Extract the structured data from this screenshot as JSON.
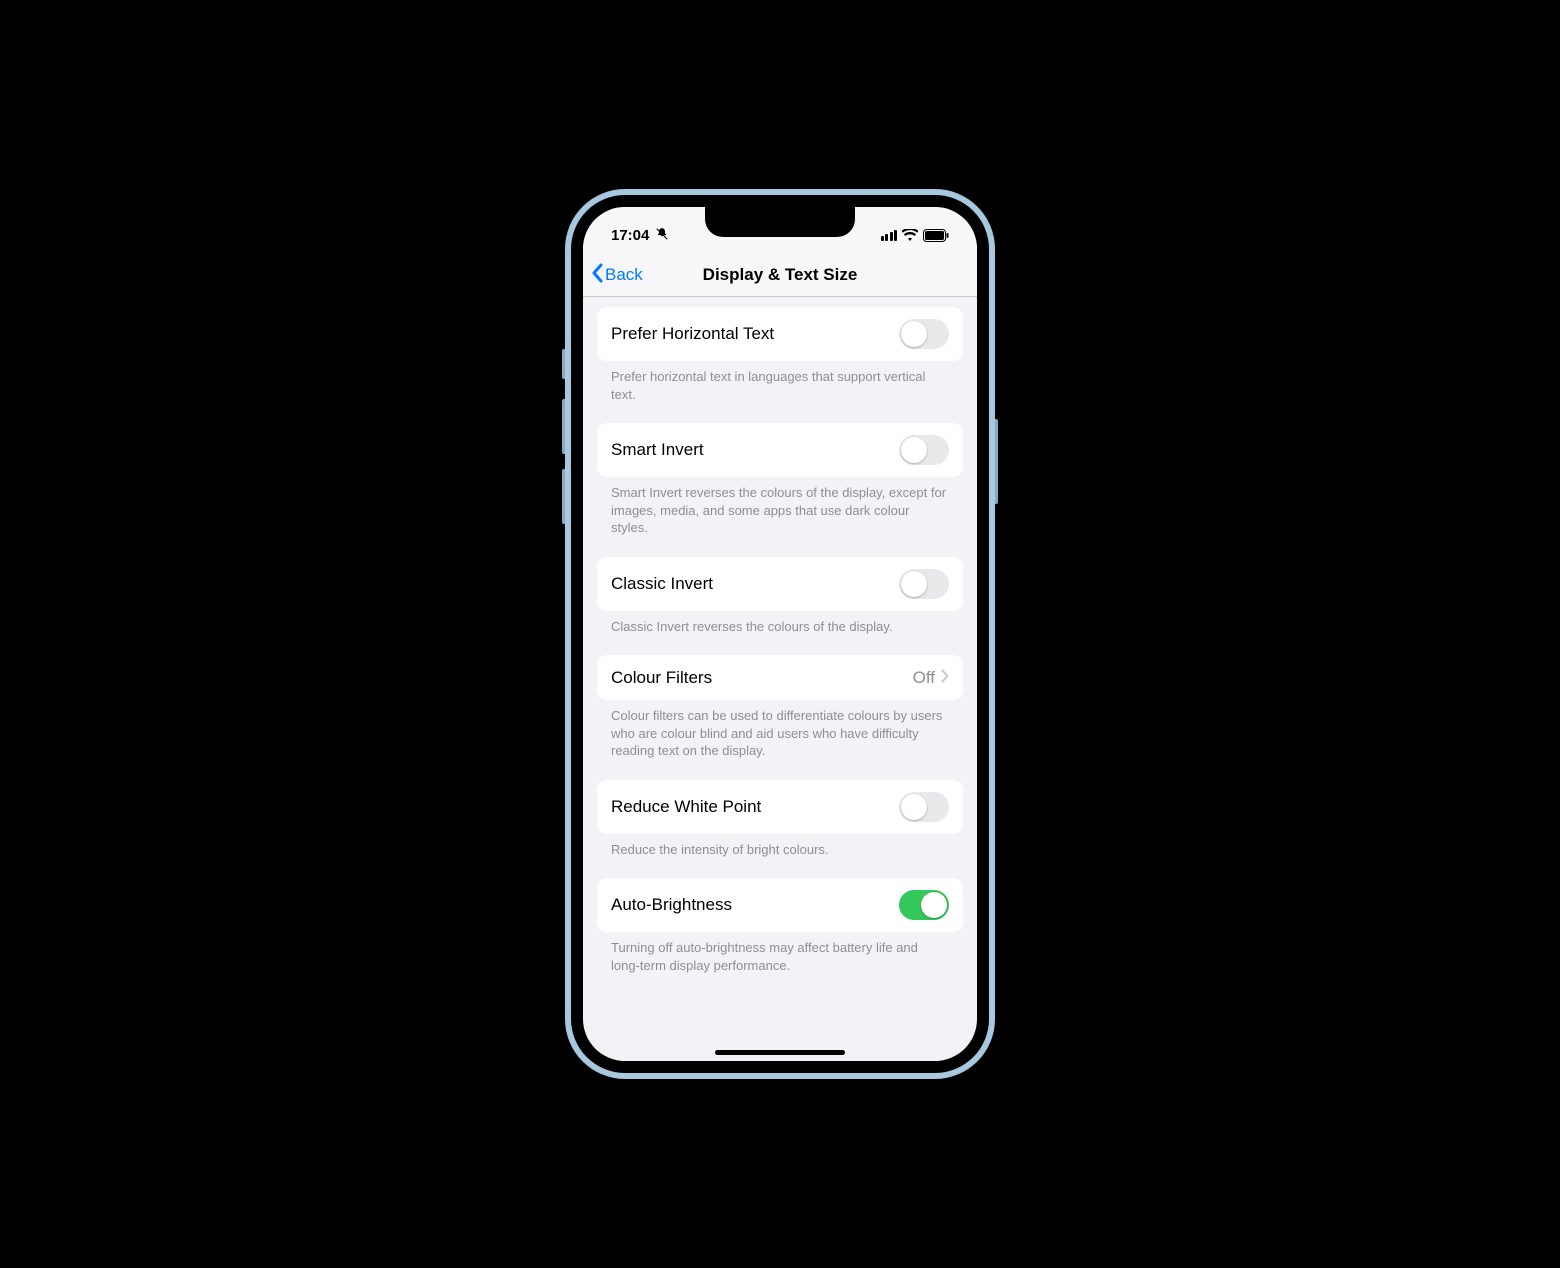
{
  "statusbar": {
    "time": "17:04",
    "silent": true,
    "cellBars": 4,
    "wifi": true,
    "batteryFull": true
  },
  "navbar": {
    "back": "Back",
    "title": "Display & Text Size"
  },
  "items": {
    "preferHorizontal": {
      "label": "Prefer Horizontal Text",
      "value": false,
      "footer": "Prefer horizontal text in languages that support vertical text."
    },
    "smartInvert": {
      "label": "Smart Invert",
      "value": false,
      "footer": "Smart Invert reverses the colours of the display, except for images, media, and some apps that use dark colour styles."
    },
    "classicInvert": {
      "label": "Classic Invert",
      "value": false,
      "footer": "Classic Invert reverses the colours of the display."
    },
    "colourFilters": {
      "label": "Colour Filters",
      "value": "Off",
      "footer": "Colour filters can be used to differentiate colours by users who are colour blind and aid users who have difficulty reading text on the display."
    },
    "reduceWhitePoint": {
      "label": "Reduce White Point",
      "value": false,
      "footer": "Reduce the intensity of bright colours."
    },
    "autoBrightness": {
      "label": "Auto-Brightness",
      "value": true,
      "footer": "Turning off auto-brightness may affect battery life and long-term display performance."
    }
  }
}
